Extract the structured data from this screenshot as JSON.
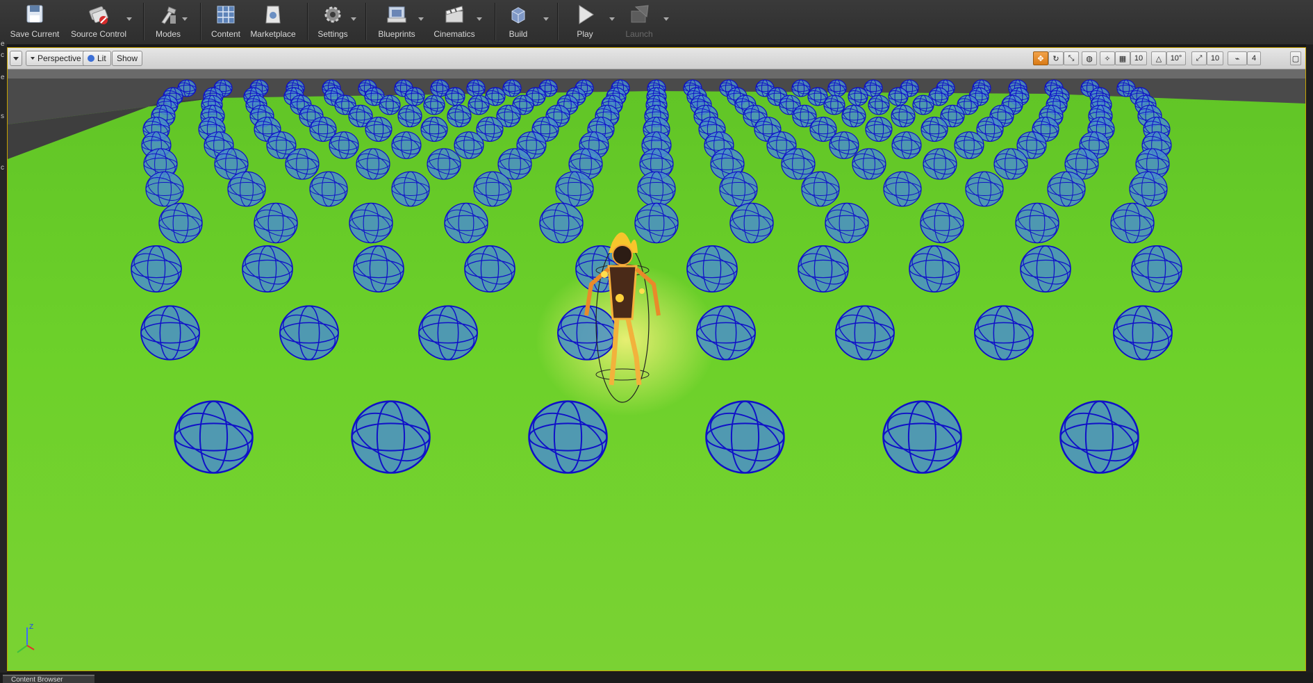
{
  "toolbar": {
    "items": [
      {
        "label": "Save Current",
        "icon": "save-icon"
      },
      {
        "label": "Source Control",
        "icon": "source-control-icon"
      },
      {
        "label": "Modes",
        "icon": "modes-icon"
      },
      {
        "label": "Content",
        "icon": "content-icon"
      },
      {
        "label": "Marketplace",
        "icon": "marketplace-icon"
      },
      {
        "label": "Settings",
        "icon": "settings-icon"
      },
      {
        "label": "Blueprints",
        "icon": "blueprints-icon"
      },
      {
        "label": "Cinematics",
        "icon": "cinematics-icon"
      },
      {
        "label": "Build",
        "icon": "build-icon"
      },
      {
        "label": "Play",
        "icon": "play-icon"
      },
      {
        "label": "Launch",
        "icon": "launch-icon"
      }
    ]
  },
  "viewport": {
    "perspective_label": "Perspective",
    "lit_label": "Lit",
    "show_label": "Show",
    "grid_snap_value": "10",
    "rotation_snap_value": "10°",
    "scale_snap_value": "10",
    "camera_speed_value": "4",
    "axis_label": "Z"
  },
  "left_strip": {
    "chars": [
      "e",
      "c",
      "e",
      "s",
      "c"
    ]
  },
  "bottom": {
    "content_browser_tab": "Content Browser"
  },
  "colors": {
    "ground": "#6fd12b",
    "sphere_fill": "#4a8fc9",
    "sphere_wire": "#1010c8",
    "selection_border": "#c8a300"
  }
}
